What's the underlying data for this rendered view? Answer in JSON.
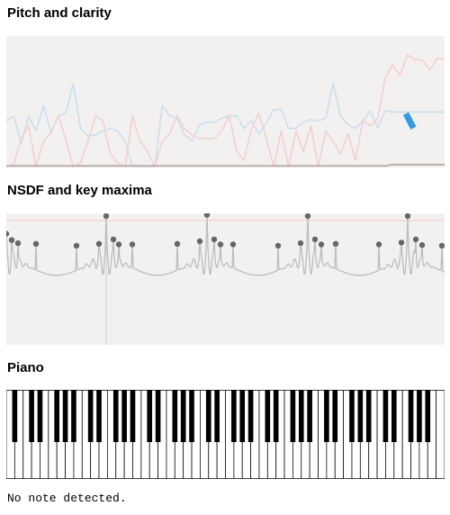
{
  "sections": {
    "pitch_title": "Pitch and clarity",
    "nsdf_title": "NSDF and key maxima",
    "piano_title": "Piano"
  },
  "status_text": "No note detected.",
  "colors": {
    "panel_bg": "#f2f1ef",
    "clarity_line": "#c9dff0",
    "pitch_line": "#f3cfd4",
    "current_marker": "#2f9de4",
    "nsdf_line": "#bdbdbd",
    "maxima_dot": "#666666",
    "threshold_line": "#f1c9cc",
    "cursor_line": "#bcd6ec"
  },
  "chart_data": [
    {
      "type": "line",
      "name": "pitch-clarity",
      "x": [
        0,
        1,
        2,
        3,
        4,
        5,
        6,
        7,
        8,
        9,
        10,
        11,
        12,
        13,
        14,
        15,
        16,
        17,
        18,
        19,
        20,
        21,
        22,
        23,
        24,
        25,
        26,
        27,
        28,
        29,
        30,
        31,
        32,
        33,
        34,
        35,
        36,
        37,
        38,
        39,
        40,
        41,
        42,
        43,
        44,
        45,
        46,
        47,
        48,
        49,
        50,
        51,
        52,
        53,
        54,
        55,
        56,
        57,
        58,
        59
      ],
      "series": [
        {
          "key": "clarity",
          "values": [
            0.36,
            0.4,
            0.18,
            0.4,
            0.28,
            0.48,
            0.27,
            0.4,
            0.42,
            0.65,
            0.3,
            0.24,
            0.25,
            0.28,
            0.3,
            0.28,
            0.2,
            0.0,
            0.0,
            0.0,
            0.0,
            0.48,
            0.4,
            0.38,
            0.25,
            0.2,
            0.33,
            0.35,
            0.35,
            0.38,
            0.4,
            0.4,
            0.3,
            0.36,
            0.26,
            0.34,
            0.45,
            0.45,
            0.3,
            0.3,
            0.35,
            0.37,
            0.36,
            0.38,
            0.66,
            0.4,
            0.33,
            0.3,
            0.36,
            0.44,
            0.3,
            0.44,
            0.43,
            0.43,
            0.43,
            0.43,
            0.43,
            0.43,
            0.43,
            0.43
          ]
        },
        {
          "key": "pitch",
          "values": [
            0.0,
            0.02,
            0.22,
            0.32,
            0.0,
            0.2,
            0.26,
            0.4,
            0.22,
            0.0,
            0.03,
            0.2,
            0.4,
            0.36,
            0.1,
            0.03,
            0.0,
            0.4,
            0.2,
            0.12,
            0.0,
            0.2,
            0.26,
            0.4,
            0.3,
            0.25,
            0.22,
            0.22,
            0.22,
            0.28,
            0.4,
            0.12,
            0.05,
            0.3,
            0.42,
            0.22,
            0.0,
            0.28,
            0.0,
            0.28,
            0.12,
            0.32,
            0.0,
            0.28,
            0.2,
            0.1,
            0.26,
            0.05,
            0.36,
            0.32,
            0.38,
            0.7,
            0.8,
            0.72,
            0.88,
            0.84,
            0.84,
            0.76,
            0.85,
            0.85
          ]
        },
        {
          "key": "baseline",
          "values": [
            0.005,
            0.005,
            0.005,
            0.005,
            0.005,
            0.005,
            0.005,
            0.005,
            0.005,
            0.005,
            0.005,
            0.005,
            0.005,
            0.005,
            0.005,
            0.005,
            0.005,
            0.005,
            0.005,
            0.005,
            0.005,
            0.005,
            0.005,
            0.005,
            0.005,
            0.005,
            0.005,
            0.005,
            0.005,
            0.005,
            0.005,
            0.005,
            0.005,
            0.005,
            0.005,
            0.005,
            0.005,
            0.005,
            0.005,
            0.005,
            0.005,
            0.005,
            0.005,
            0.005,
            0.005,
            0.005,
            0.005,
            0.005,
            0.005,
            0.005,
            0.005,
            0.005,
            0.015,
            0.015,
            0.015,
            0.015,
            0.015,
            0.015,
            0.015,
            0.015
          ]
        }
      ],
      "current": {
        "x": 54.3,
        "y": 0.36
      },
      "xlim": [
        0,
        59
      ],
      "ylim": [
        0,
        1
      ],
      "grid": false
    },
    {
      "type": "line",
      "name": "nsdf",
      "x_count": 488,
      "threshold": 0.93,
      "cursor_x": 111,
      "maxima": [
        {
          "x": 0,
          "y": 0.72
        },
        {
          "x": 6,
          "y": 0.62
        },
        {
          "x": 13,
          "y": 0.57
        },
        {
          "x": 33,
          "y": 0.56
        },
        {
          "x": 78,
          "y": 0.53
        },
        {
          "x": 103,
          "y": 0.56
        },
        {
          "x": 111,
          "y": 1.0
        },
        {
          "x": 119,
          "y": 0.63
        },
        {
          "x": 125,
          "y": 0.55
        },
        {
          "x": 140,
          "y": 0.55
        },
        {
          "x": 190,
          "y": 0.56
        },
        {
          "x": 215,
          "y": 0.6
        },
        {
          "x": 223,
          "y": 1.02
        },
        {
          "x": 231,
          "y": 0.63
        },
        {
          "x": 238,
          "y": 0.55
        },
        {
          "x": 252,
          "y": 0.55
        },
        {
          "x": 302,
          "y": 0.53
        },
        {
          "x": 327,
          "y": 0.57
        },
        {
          "x": 335,
          "y": 1.0
        },
        {
          "x": 343,
          "y": 0.63
        },
        {
          "x": 350,
          "y": 0.55
        },
        {
          "x": 366,
          "y": 0.56
        },
        {
          "x": 414,
          "y": 0.55
        },
        {
          "x": 439,
          "y": 0.58
        },
        {
          "x": 446,
          "y": 1.0
        },
        {
          "x": 455,
          "y": 0.63
        },
        {
          "x": 462,
          "y": 0.54
        },
        {
          "x": 484,
          "y": 0.53
        }
      ],
      "ylim": [
        -1,
        1
      ]
    }
  ],
  "piano": {
    "white_key_count": 52,
    "black_key_pattern": [
      1,
      0,
      1,
      1,
      0,
      1,
      1
    ]
  }
}
